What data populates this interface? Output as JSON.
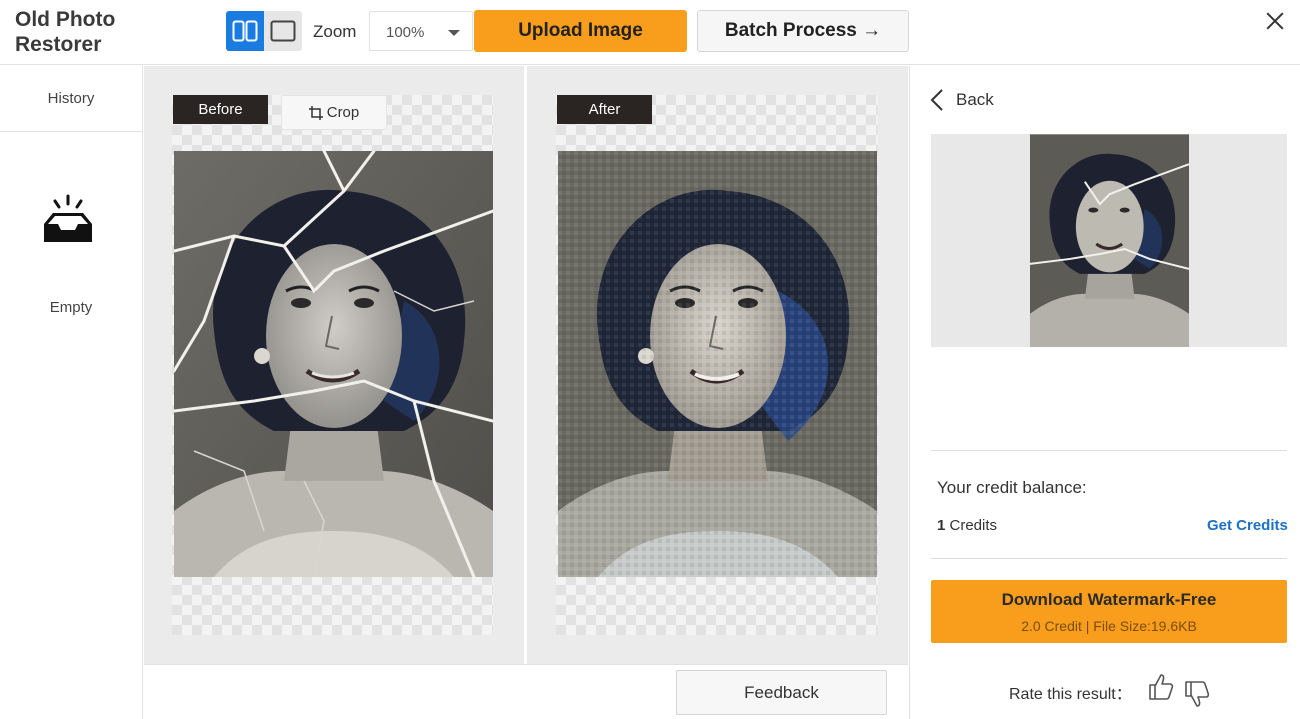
{
  "app": {
    "title": "Old Photo Restorer"
  },
  "toolbar": {
    "view_modes": [
      "split-view",
      "single-view"
    ],
    "zoom_label": "Zoom",
    "zoom_value": "100%",
    "upload_label": "Upload Image",
    "batch_label": "Batch Process →"
  },
  "sidebar": {
    "history_label": "History",
    "empty_label": "Empty",
    "empty_icon": "empty-tray-icon"
  },
  "compare": {
    "before_label": "Before",
    "crop_label": "Crop",
    "after_label": "After",
    "feedback_label": "Feedback"
  },
  "result": {
    "back_label": "Back",
    "credit_balance_label": "Your credit balance:",
    "credits_count": "1",
    "credits_unit": " Credits",
    "get_credits_label": "Get Credits",
    "download_label": "Download Watermark-Free",
    "download_info": "2.0 Credit | File Size:19.6KB",
    "rate_label": "Rate this result："
  },
  "colors": {
    "accent_orange": "#f99d1c",
    "accent_blue": "#1a7ce0",
    "link_blue": "#1d72c4",
    "tag_dark": "#2a2422"
  }
}
